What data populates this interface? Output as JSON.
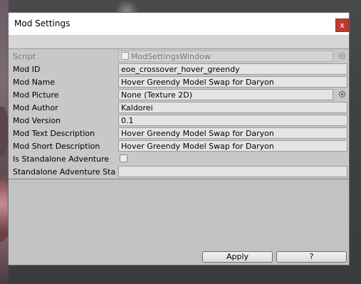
{
  "window": {
    "title": "Mod Settings",
    "close_glyph": "x"
  },
  "fields": {
    "script": {
      "label": "Script",
      "value": "ModSettingsWindow"
    },
    "mod_id": {
      "label": "Mod ID",
      "value": "eoe_crossover_hover_greendy"
    },
    "mod_name": {
      "label": "Mod Name",
      "value": "Hover Greendy Model Swap for Daryon"
    },
    "mod_picture": {
      "label": "Mod Picture",
      "value": "None (Texture 2D)"
    },
    "mod_author": {
      "label": "Mod Author",
      "value": "Kaldorei"
    },
    "mod_version": {
      "label": "Mod Version",
      "value": "0.1"
    },
    "mod_text_description": {
      "label": "Mod Text Description",
      "value": "Hover Greendy Model Swap for Daryon"
    },
    "mod_short_description": {
      "label": "Mod Short Description",
      "value": "Hover Greendy Model Swap for Daryon"
    },
    "is_standalone": {
      "label": "Is Standalone Adventure",
      "checked": false
    },
    "standalone_start": {
      "label": "Standalone Adventure Sta",
      "value": ""
    }
  },
  "buttons": {
    "apply": "Apply",
    "help": "?"
  },
  "colors": {
    "close_button": "#c0392b",
    "window_bg": "#c2c2c2"
  }
}
